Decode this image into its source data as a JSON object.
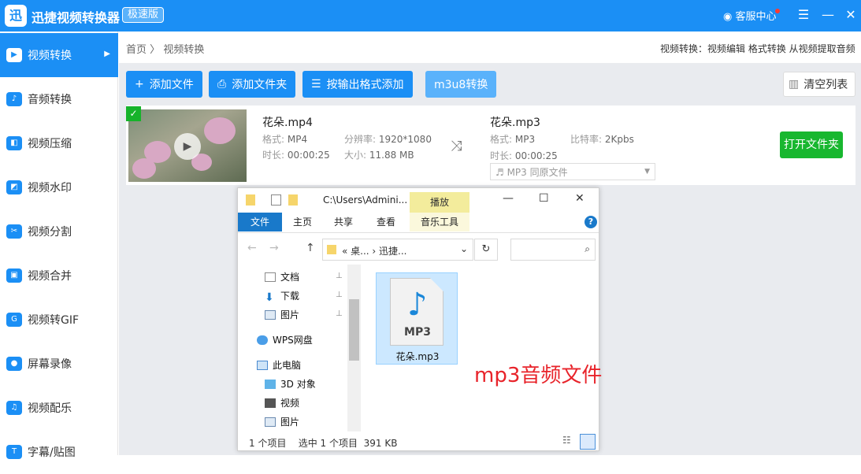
{
  "titlebar": {
    "logo": "迅",
    "title": "迅捷视频转换器",
    "badge": "极速版",
    "service": "客服中心",
    "menu": "☰",
    "min": "—",
    "close": "✕"
  },
  "sidebar": {
    "items": [
      {
        "label": "视频转换",
        "icon": "▶"
      },
      {
        "label": "音频转换",
        "icon": "♪"
      },
      {
        "label": "视频压缩",
        "icon": "◧"
      },
      {
        "label": "视频水印",
        "icon": "◩"
      },
      {
        "label": "视频分割",
        "icon": "✂"
      },
      {
        "label": "视频合并",
        "icon": "▣"
      },
      {
        "label": "视频转GIF",
        "icon": "G"
      },
      {
        "label": "屏幕录像",
        "icon": "●"
      },
      {
        "label": "视频配乐",
        "icon": "♫"
      },
      {
        "label": "字幕/贴图",
        "icon": "T"
      }
    ],
    "arrow": "▶"
  },
  "breadcrumb": {
    "home": "首页",
    "sep": "〉",
    "current": "视频转换"
  },
  "tool_info": "视频转换：视频编辑 格式转换 从视频提取音频",
  "toolbar": {
    "add_file": "添加文件",
    "add_folder": "添加文件夹",
    "add_by_format": "按输出格式添加",
    "m3u8": "m3u8转换",
    "clear": "清空列表",
    "add_file_icon": "+",
    "add_folder_icon": "⎙",
    "format_icon": "☰",
    "clear_icon": "▥"
  },
  "file_item": {
    "source": {
      "name": "花朵.mp4",
      "format_label": "格式:",
      "format": "MP4",
      "res_label": "分辨率:",
      "resolution": "1920*1080",
      "dur_label": "时长:",
      "duration": "00:00:25",
      "size_label": "大小:",
      "size": "11.88 MB"
    },
    "shuffle_icon": "⤨",
    "output": {
      "name": "花朵.mp3",
      "format_label": "格式:",
      "format": "MP3",
      "bitrate_label": "比特率:",
      "bitrate": "2Kpbs",
      "dur_label": "时长:",
      "duration": "00:00:25"
    },
    "format_select": "♬ MP3   同原文件",
    "select_arrow": "▼",
    "open_folder": "打开文件夹",
    "check_icon": "✓",
    "play_icon": "▶"
  },
  "explorer": {
    "path": "C:\\Users\\Admini...",
    "play_tab": "播放",
    "tabs": [
      "文件",
      "主页",
      "共享",
      "查看",
      "音乐工具"
    ],
    "address": {
      "part1": "桌...",
      "part2": "迅捷..."
    },
    "nav": [
      "文档",
      "下载",
      "图片",
      "WPS网盘",
      "此电脑",
      "3D 对象",
      "视频",
      "图片"
    ],
    "file_label": "MP3",
    "file_name": "花朵.mp3",
    "status": {
      "count": "1 个项目",
      "selected": "选中 1 个项目",
      "size": "391 KB"
    },
    "win_min": "—",
    "win_max": "☐",
    "win_close": "✕"
  },
  "annotation": "mp3音频文件"
}
